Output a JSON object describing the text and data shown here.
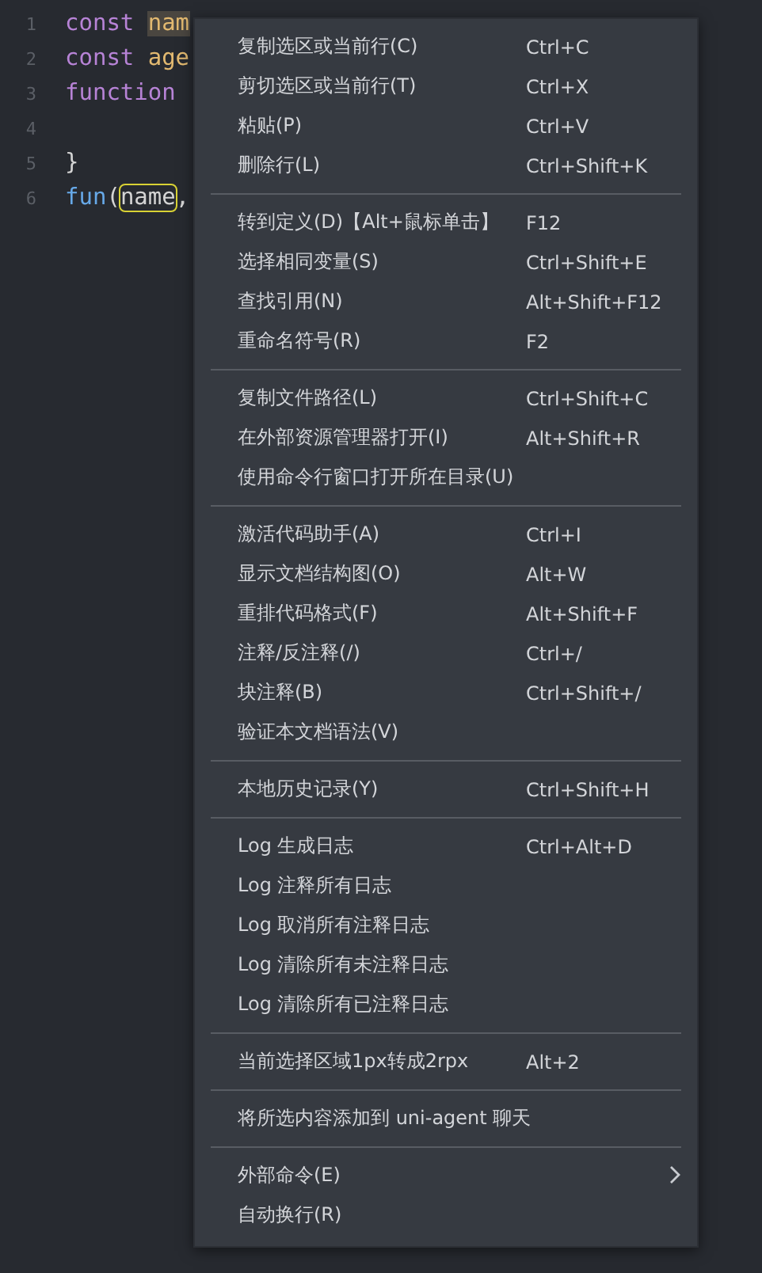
{
  "editor": {
    "lines": [
      {
        "number": "1",
        "words": [
          [
            {
              "text": "const",
              "kind": "keyword"
            }
          ],
          [
            {
              "text": "nam",
              "kind": "variable",
              "highlighted": true
            }
          ]
        ]
      },
      {
        "number": "2",
        "words": [
          [
            {
              "text": "const",
              "kind": "keyword"
            }
          ],
          [
            {
              "text": "age",
              "kind": "variable"
            }
          ]
        ]
      },
      {
        "number": "3",
        "words": [
          [
            {
              "text": "function",
              "kind": "keyword"
            }
          ]
        ]
      },
      {
        "number": "4"
      },
      {
        "number": "5",
        "words": [
          [
            {
              "text": "}",
              "kind": "plain"
            }
          ]
        ]
      },
      {
        "number": "6",
        "words": [
          [
            {
              "text": "fun",
              "kind": "function"
            },
            {
              "text": "(",
              "kind": "plain"
            },
            {
              "text": "name",
              "kind": "plain",
              "boxed": true
            },
            {
              "text": ",",
              "kind": "plain"
            }
          ]
        ]
      }
    ]
  },
  "context_menu": {
    "groups": [
      [
        {
          "label": "复制选区或当前行(C)",
          "shortcut": "Ctrl+C"
        },
        {
          "label": "剪切选区或当前行(T)",
          "shortcut": "Ctrl+X"
        },
        {
          "label": "粘贴(P)",
          "shortcut": "Ctrl+V"
        },
        {
          "label": "删除行(L)",
          "shortcut": "Ctrl+Shift+K"
        }
      ],
      [
        {
          "label": "转到定义(D)【Alt+鼠标单击】",
          "shortcut": "F12"
        },
        {
          "label": "选择相同变量(S)",
          "shortcut": "Ctrl+Shift+E"
        },
        {
          "label": "查找引用(N)",
          "shortcut": "Alt+Shift+F12"
        },
        {
          "label": "重命名符号(R)",
          "shortcut": "F2"
        }
      ],
      [
        {
          "label": "复制文件路径(L)",
          "shortcut": "Ctrl+Shift+C"
        },
        {
          "label": "在外部资源管理器打开(I)",
          "shortcut": "Alt+Shift+R"
        },
        {
          "label": "使用命令行窗口打开所在目录(U)"
        }
      ],
      [
        {
          "label": "激活代码助手(A)",
          "shortcut": "Ctrl+I"
        },
        {
          "label": "显示文档结构图(O)",
          "shortcut": "Alt+W"
        },
        {
          "label": "重排代码格式(F)",
          "shortcut": "Alt+Shift+F"
        },
        {
          "label": "注释/反注释(/)",
          "shortcut": "Ctrl+/"
        },
        {
          "label": "块注释(B)",
          "shortcut": "Ctrl+Shift+/"
        },
        {
          "label": "验证本文档语法(V)"
        }
      ],
      [
        {
          "label": "本地历史记录(Y)",
          "shortcut": "Ctrl+Shift+H"
        }
      ],
      [
        {
          "label": "Log 生成日志",
          "shortcut": "Ctrl+Alt+D"
        },
        {
          "label": "Log 注释所有日志"
        },
        {
          "label": "Log 取消所有注释日志"
        },
        {
          "label": "Log 清除所有未注释日志"
        },
        {
          "label": "Log 清除所有已注释日志"
        }
      ],
      [
        {
          "label": "当前选择区域1px转成2rpx",
          "shortcut": "Alt+2"
        }
      ],
      [
        {
          "label": "将所选内容添加到 uni-agent 聊天"
        }
      ],
      [
        {
          "label": "外部命令(E)",
          "submenu": true
        },
        {
          "label": "自动换行(R)"
        }
      ]
    ]
  }
}
